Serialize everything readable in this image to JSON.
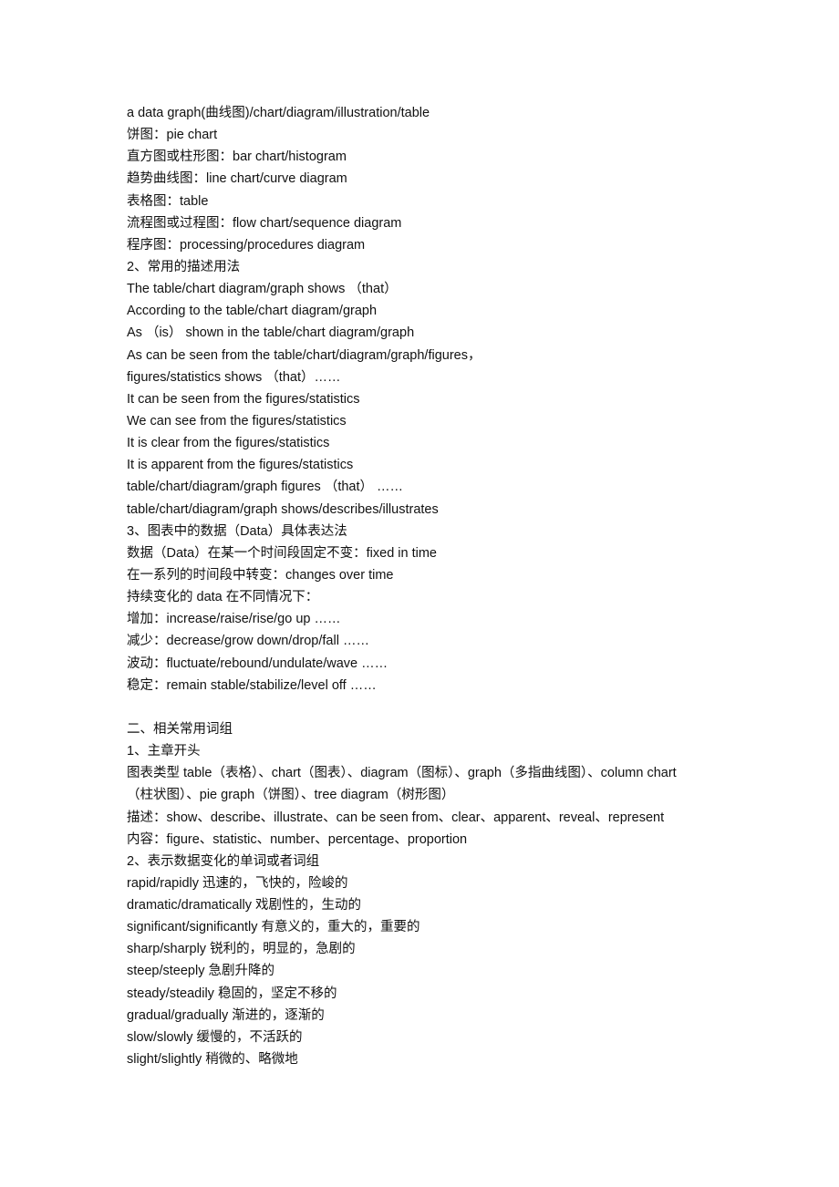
{
  "lines": [
    "a data graph(曲线图)/chart/diagram/illustration/table",
    "饼图：pie chart",
    "直方图或柱形图：bar chart/histogram",
    "趋势曲线图：line chart/curve diagram",
    "表格图：table",
    "流程图或过程图：flow chart/sequence diagram",
    "程序图：processing/procedures diagram",
    "2、常用的描述用法",
    "The table/chart diagram/graph shows （that）",
    "According to the table/chart diagram/graph",
    "As （is） shown in the table/chart diagram/graph",
    "As can be seen from the table/chart/diagram/graph/figures，",
    "figures/statistics shows （that）……",
    "It can be seen from the figures/statistics",
    "We can see from the figures/statistics",
    "It is clear from the figures/statistics",
    "It is apparent from the figures/statistics",
    "table/chart/diagram/graph figures （that） ……",
    "table/chart/diagram/graph shows/describes/illustrates",
    "3、图表中的数据（Data）具体表达法",
    "数据（Data）在某一个时间段固定不变：fixed in time",
    "在一系列的时间段中转变：changes over time",
    "持续变化的 data 在不同情况下：",
    "增加：increase/raise/rise/go up ……",
    "减少：decrease/grow down/drop/fall ……",
    "波动：fluctuate/rebound/undulate/wave ……",
    "稳定：remain stable/stabilize/level off ……",
    "",
    "二、相关常用词组",
    "1、主章开头",
    "图表类型 table（表格）、chart（图表）、diagram（图标）、graph（多指曲线图）、column chart",
    "（柱状图）、pie graph（饼图）、tree diagram（树形图）",
    "描述：show、describe、illustrate、can be seen from、clear、apparent、reveal、represent",
    "内容：figure、statistic、number、percentage、proportion",
    "2、表示数据变化的单词或者词组",
    "rapid/rapidly 迅速的，飞快的，险峻的",
    "dramatic/dramatically 戏剧性的，生动的",
    "significant/significantly 有意义的，重大的，重要的",
    "sharp/sharply 锐利的，明显的，急剧的",
    "steep/steeply 急剧升降的",
    "steady/steadily 稳固的，坚定不移的",
    "gradual/gradually 渐进的，逐渐的",
    "slow/slowly 缓慢的，不活跃的",
    "slight/slightly 稍微的、略微地"
  ]
}
